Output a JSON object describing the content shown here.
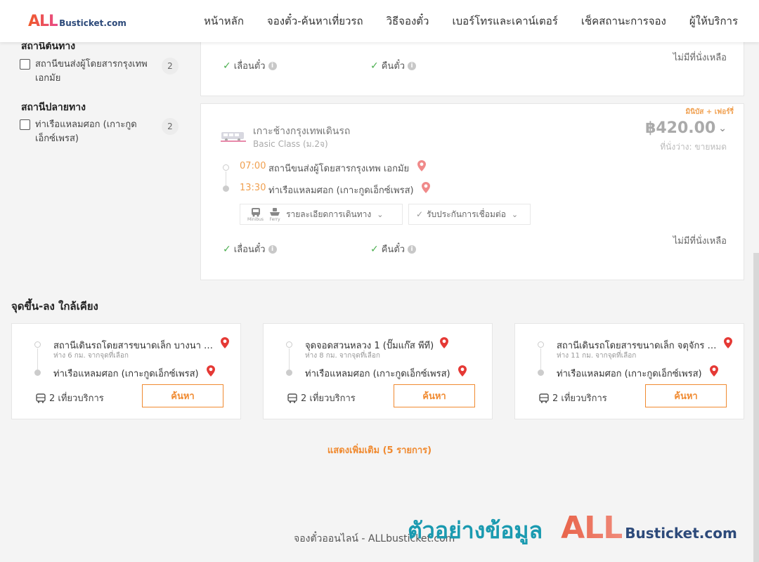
{
  "header": {
    "logo_all": "ALL",
    "logo_bt": "Busticket.com",
    "nav": [
      "หน้าหลัก",
      "จองตั๋ว-ค้นหาเที่ยวรถ",
      "วิธีจองตั๋ว",
      "เบอร์โทรและเคาน์เตอร์",
      "เช็คสถานะการจอง",
      "ผู้ให้บริการ"
    ]
  },
  "filters": {
    "origin_title": "สถานีต้นทาง",
    "origin_item": "สถานีขนส่งผู้โดยสารกรุงเทพ เอกมัย",
    "origin_count": "2",
    "dest_title": "สถานีปลายทาง",
    "dest_item": "ท่าเรือแหลมศอก (เกาะกูดเอ็กซ์เพรส)",
    "dest_count": "2"
  },
  "card1": {
    "reschedule": "เลื่อนตั๋ว",
    "refund": "คืนตั๋ว",
    "no_seat": "ไม่มีที่นั่งเหลือ"
  },
  "card2": {
    "tag": "มินิบัส + เฟอร์รี่",
    "operator": "เกาะช้างกรุงเทพเดินรถ",
    "class": "Basic Class (ม.2จ)",
    "price": "฿420.00",
    "seats": "ที่นั่งว่าง: ขายหมด",
    "dep_time": "07:00",
    "dep_station": "สถานีขนส่งผู้โดยสารกรุงเทพ เอกมัย",
    "arr_time": "13:30",
    "arr_station": "ท่าเรือแหลมศอก (เกาะกูดเอ็กซ์เพรส)",
    "minibus_label": "Minibus",
    "ferry_label": "Ferry",
    "route_details": "รายละเอียดการเดินทาง",
    "connection_guarantee": "รับประกันการเชื่อมต่อ",
    "reschedule": "เลื่อนตั๋ว",
    "refund": "คืนตั๋ว",
    "no_seat": "ไม่มีที่นั่งเหลือ"
  },
  "nearby": {
    "title": "จุดขึ้น-ลง ใกล้เคียง",
    "cards": [
      {
        "from": "สถานีเดินรถโดยสารขนาดเล็ก บางนา (บางนา)",
        "dist": "ห่าง 6 กม. จากจุดที่เลือก",
        "to": "ท่าเรือแหลมศอก (เกาะกูดเอ็กซ์เพรส)",
        "trips": "2 เที่ยวบริการ",
        "button": "ค้นหา"
      },
      {
        "from": "จุดจอดสวนหลวง 1 (ปั๊มแก๊ส พีที)",
        "dist": "ห่าง 8 กม. จากจุดที่เลือก",
        "to": "ท่าเรือแหลมศอก (เกาะกูดเอ็กซ์เพรส)",
        "trips": "2 เที่ยวบริการ",
        "button": "ค้นหา"
      },
      {
        "from": "สถานีเดินรถโดยสารขนาดเล็ก จตุจักร (จตุจักร)",
        "dist": "ห่าง 11 กม. จากจุดที่เลือก",
        "to": "ท่าเรือแหลมศอก (เกาะกูดเอ็กซ์เพรส)",
        "trips": "2 เที่ยวบริการ",
        "button": "ค้นหา"
      }
    ],
    "more": "แสดงเพิ่มเติม (5 รายการ)"
  },
  "footer": {
    "text": "จองตั๋วออนไลน์ - ALLbusticket.com",
    "watermark_thai": "ตัวอย่างข้อมูล",
    "watermark_all": "ALL",
    "watermark_bt": "Busticket.com"
  },
  "colors": {
    "accent": "#f08a30",
    "check": "#4caf50",
    "pin": "#e53935"
  }
}
